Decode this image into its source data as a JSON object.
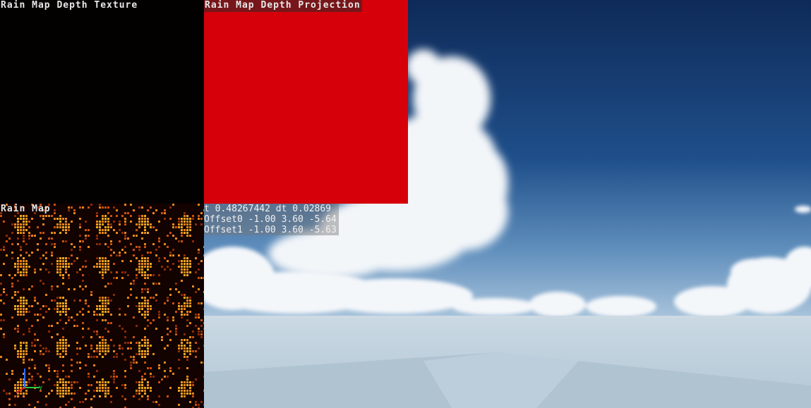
{
  "panels": {
    "depth_texture": {
      "title": "Rain Map Depth Texture"
    },
    "depth_projection": {
      "title": "Rain Map Depth Projection"
    },
    "rain_map": {
      "title": "Rain Map"
    }
  },
  "stats": {
    "time_line": "t 0.48267442 dt 0.02869",
    "offset0_line": "Offset0 -1.00 3.60 -5.64",
    "offset1_line": "Offset1 -1.00 3.60 -5.63"
  },
  "gizmo": {
    "y_label": "Y"
  },
  "colors": {
    "sky_top": "#0f2c5a",
    "sky_horizon": "#7ea6c9",
    "projection_red": "#d6000a",
    "rain_orange": "#f2a81d"
  }
}
